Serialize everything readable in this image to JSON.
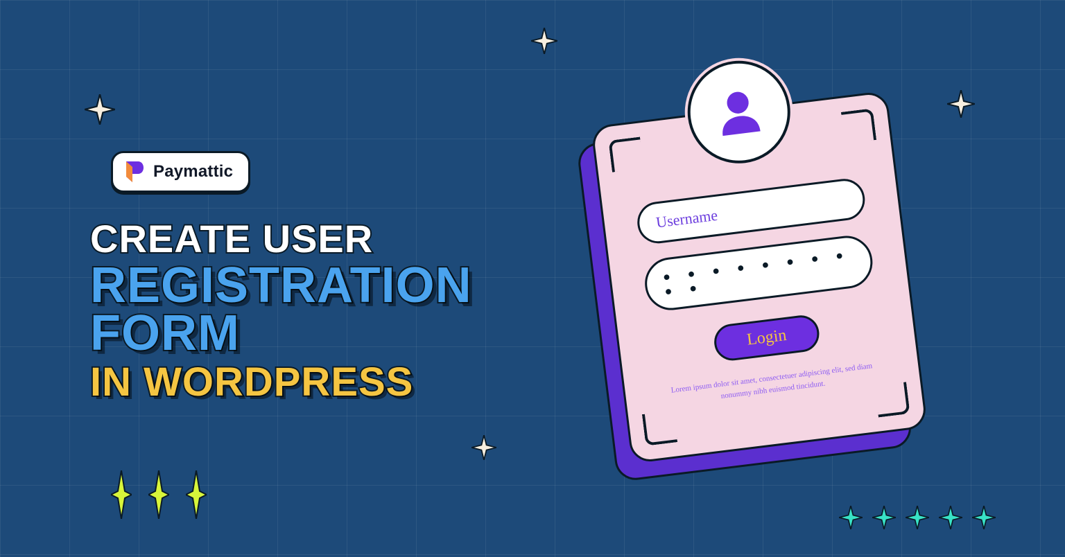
{
  "logo": {
    "name": "Paymattic"
  },
  "headline": {
    "line1": "CREATE USER",
    "line2": "REGISTRATION FORM",
    "line3": "IN WORDPRESS"
  },
  "card": {
    "username_placeholder": "Username",
    "password_masked": "● ● ● ● ● ● ● ● ● ●",
    "login_label": "Login",
    "lorem": "Lorem ipsum dolor sit amet, consectetuer adipiscing elit, sed diam nonummy nibh euismod tincidunt."
  }
}
